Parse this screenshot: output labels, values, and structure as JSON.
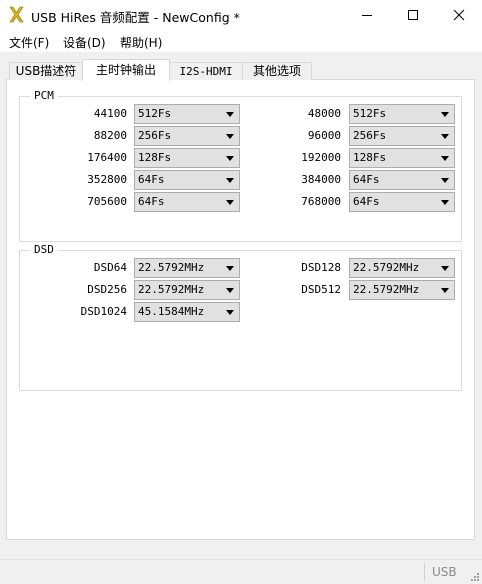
{
  "window": {
    "title": "USB HiRes 音频配置 - NewConfig *",
    "minimize_glyph": "minimize-icon",
    "maximize_glyph": "maximize-icon",
    "close_glyph": "close-icon"
  },
  "menu": {
    "items": [
      "文件(F)",
      "设备(D)",
      "帮助(H)"
    ]
  },
  "tabs": [
    {
      "label": "USB描述符",
      "active": false
    },
    {
      "label": "主时钟输出",
      "active": true
    },
    {
      "label": "I2S-HDMI",
      "active": false
    },
    {
      "label": "其他选项",
      "active": false
    }
  ],
  "pcm": {
    "legend": "PCM",
    "rows": [
      {
        "left_label": "44100",
        "left_value": "512Fs",
        "right_label": "48000",
        "right_value": "512Fs"
      },
      {
        "left_label": "88200",
        "left_value": "256Fs",
        "right_label": "96000",
        "right_value": "256Fs"
      },
      {
        "left_label": "176400",
        "left_value": "128Fs",
        "right_label": "192000",
        "right_value": "128Fs"
      },
      {
        "left_label": "352800",
        "left_value": "64Fs",
        "right_label": "384000",
        "right_value": "64Fs"
      },
      {
        "left_label": "705600",
        "left_value": "64Fs",
        "right_label": "768000",
        "right_value": "64Fs"
      }
    ]
  },
  "dsd": {
    "legend": "DSD",
    "rows": [
      {
        "left_label": "DSD64",
        "left_value": "22.5792MHz",
        "right_label": "DSD128",
        "right_value": "22.5792MHz"
      },
      {
        "left_label": "DSD256",
        "left_value": "22.5792MHz",
        "right_label": "DSD512",
        "right_value": "22.5792MHz"
      },
      {
        "left_label": "DSD1024",
        "left_value": "45.1584MHz"
      }
    ]
  },
  "status": {
    "device": "USB"
  },
  "colors": {
    "accent_icon": "#e8b400",
    "status_text": "#8a8a8a",
    "combo_bg": "#e1e1e1"
  }
}
